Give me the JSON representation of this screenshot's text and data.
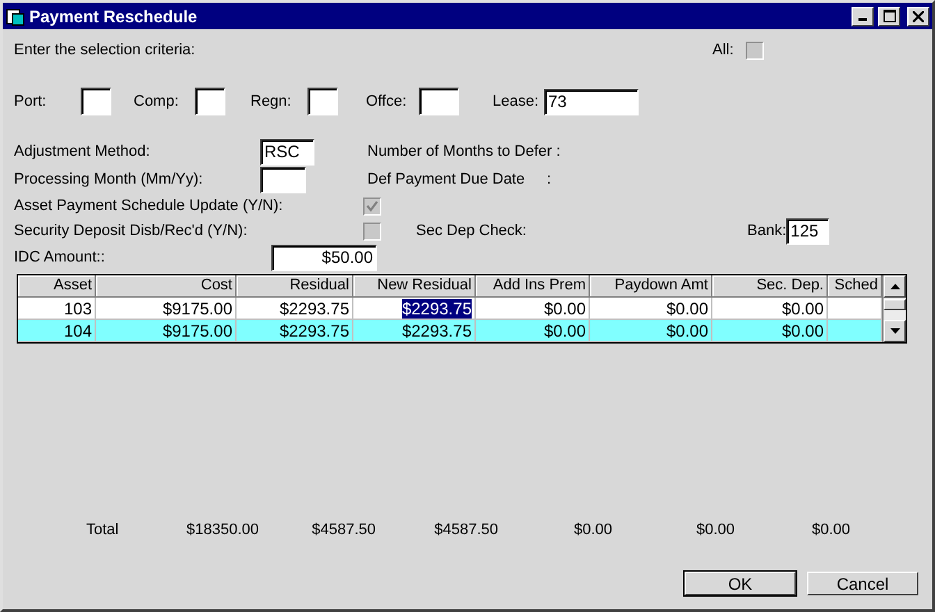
{
  "window": {
    "title": "Payment Reschedule"
  },
  "criteria": {
    "prompt": "Enter the selection criteria:",
    "all": {
      "label": "All:",
      "checked": false,
      "disabled": true
    },
    "fields": [
      {
        "label": "Port:"
      },
      {
        "label": "Comp:"
      },
      {
        "label": "Regn:"
      },
      {
        "label": "Offce:"
      },
      {
        "label": "Lease:",
        "value": "73"
      }
    ]
  },
  "adjustment_method": {
    "label": "Adjustment Method:",
    "value": "RSC"
  },
  "processing_month": {
    "label": "Processing Month (Mm/Yy):"
  },
  "months_to_defer": {
    "label": "Number of Months to Defer :"
  },
  "def_payment_due": {
    "label": "Def Payment Due Date",
    "colon": ":"
  },
  "asset_schedule_update": {
    "label": "Asset Payment Schedule Update (Y/N):",
    "checked": true,
    "disabled": true
  },
  "security_deposit": {
    "label": "Security Deposit Disb/Rec'd (Y/N):",
    "checked": false,
    "disabled": true
  },
  "sec_dep_check": {
    "label": "Sec Dep Check:"
  },
  "bank": {
    "label": "Bank:",
    "value": "125"
  },
  "idc_amount": {
    "label": "IDC Amount::",
    "value": "$50.00"
  },
  "table": {
    "columns": [
      "Asset",
      "Cost",
      "Residual",
      "New Residual",
      "Add Ins Prem",
      "Paydown Amt",
      "Sec. Dep.",
      "Sched"
    ],
    "rows": [
      {
        "selected": false,
        "cells": [
          {
            "text": "103",
            "highlighted": false
          },
          {
            "text": "$9175.00",
            "highlighted": false
          },
          {
            "text": "$2293.75",
            "highlighted": false
          },
          {
            "text": "$2293.75",
            "highlighted": true
          },
          {
            "text": "$0.00",
            "highlighted": false
          },
          {
            "text": "$0.00",
            "highlighted": false
          },
          {
            "text": "$0.00",
            "highlighted": false
          },
          {
            "highlighted": false
          }
        ]
      },
      {
        "selected": true,
        "cells": [
          {
            "text": "104",
            "highlighted": false
          },
          {
            "text": "$9175.00",
            "highlighted": false
          },
          {
            "text": "$2293.75",
            "highlighted": false
          },
          {
            "text": "$2293.75",
            "highlighted": false
          },
          {
            "text": "$0.00",
            "highlighted": false
          },
          {
            "text": "$0.00",
            "highlighted": false
          },
          {
            "text": "$0.00",
            "highlighted": false
          },
          {
            "highlighted": false
          }
        ]
      }
    ]
  },
  "totals": {
    "label": "Total",
    "values": [
      "$18350.00",
      "$4587.50",
      "$4587.50",
      "$0.00",
      "$0.00",
      "$0.00"
    ]
  },
  "buttons": [
    {
      "label": "OK",
      "default": true
    },
    {
      "label": "Cancel",
      "default": false
    }
  ]
}
